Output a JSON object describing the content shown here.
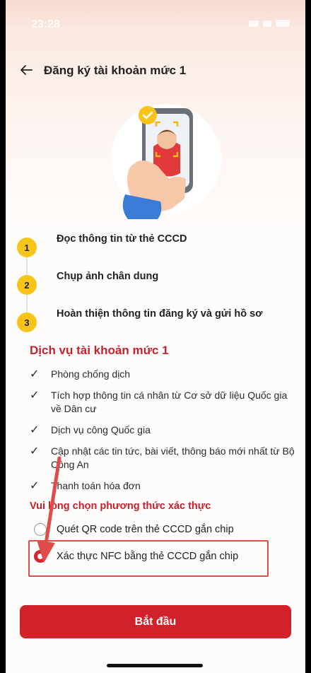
{
  "status_bar": {
    "time": "23:28"
  },
  "header": {
    "title": "Đăng ký tài khoản mức 1",
    "back_icon": "arrow-left-icon"
  },
  "steps": [
    {
      "number": "1",
      "label": "Đọc thông tin từ thẻ CCCD"
    },
    {
      "number": "2",
      "label": "Chụp ảnh chân dung"
    },
    {
      "number": "3",
      "label": "Hoàn thiện thông tin đăng ký và gửi hồ sơ"
    }
  ],
  "services": {
    "title": "Dịch vụ tài khoản mức 1",
    "items": [
      "Phòng chống dịch",
      "Tích hợp thông tin cá nhân từ Cơ sở dữ liệu Quốc gia về Dân cư",
      "Dịch vụ công Quốc gia",
      "Cập nhật các tin tức, bài viết, thông báo mới nhất từ Bộ Công An",
      "Thanh toán hóa đơn"
    ]
  },
  "verification": {
    "title": "Vui lòng chọn phương thức xác thực",
    "options": [
      {
        "label": "Quét QR code trên thẻ CCCD gắn chip",
        "selected": false
      },
      {
        "label": "Xác thực NFC bằng thẻ CCCD gắn chip",
        "selected": true
      }
    ]
  },
  "start_button": {
    "label": "Bắt đầu"
  },
  "colors": {
    "brand_red": "#d1222c",
    "step_yellow": "#f7c51a",
    "annotation_red": "#e24b4b"
  }
}
